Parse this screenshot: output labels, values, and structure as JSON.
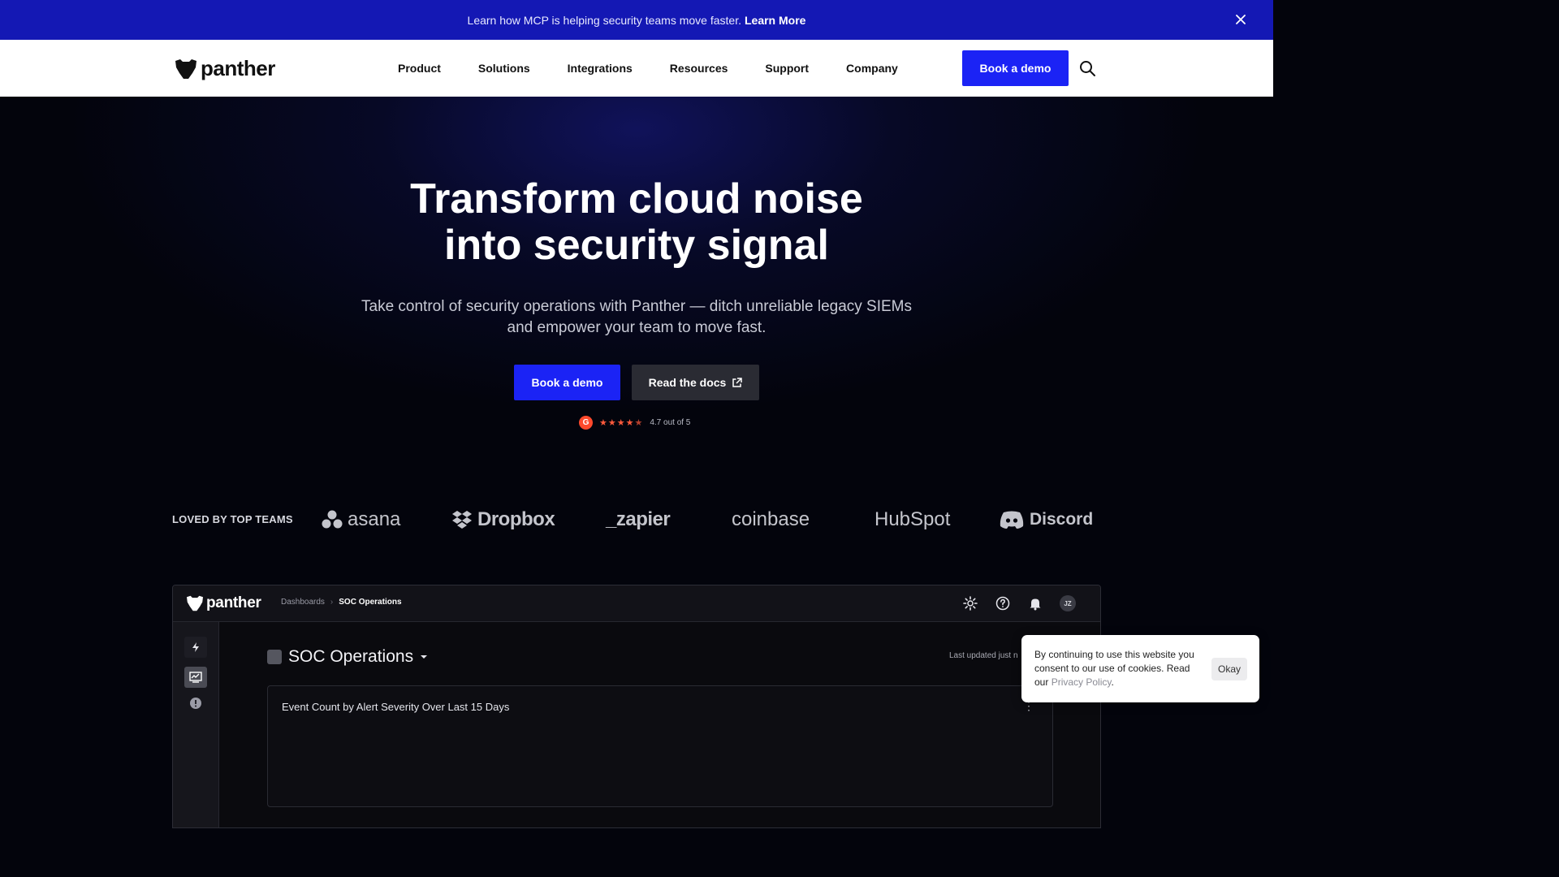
{
  "announcement": {
    "text": "Learn how MCP is helping security teams move faster.",
    "link": "Learn More"
  },
  "nav": {
    "logo": "panther",
    "links": [
      "Product",
      "Solutions",
      "Integrations",
      "Resources",
      "Support",
      "Company"
    ],
    "cta": "Book a demo"
  },
  "hero": {
    "title_line1": "Transform cloud noise",
    "title_line2": "into security signal",
    "subtitle_line1": "Take control of security operations with Panther — ditch unreliable legacy SIEMs",
    "subtitle_line2": "and empower your team to move fast.",
    "primary_cta": "Book a demo",
    "secondary_cta": "Read the docs",
    "rating_text": "4.7 out of 5",
    "rating_value": 4.7,
    "rating_max": 5
  },
  "logos": {
    "label": "LOVED BY TOP TEAMS",
    "brands": [
      "asana",
      "Dropbox",
      "_zapier",
      "coinbase",
      "HubSpot",
      "Discord"
    ]
  },
  "app": {
    "logo": "panther",
    "breadcrumb": [
      "Dashboards",
      "SOC Operations"
    ],
    "avatar": "JZ",
    "dashboard_title": "SOC Operations",
    "last_updated": "Last updated just n",
    "panel_title": "Event Count by Alert Severity Over Last 15 Days"
  },
  "cookie": {
    "text": "By continuing to use this website you consent to our use of cookies. Read our",
    "link": "Privacy Policy",
    "period": ".",
    "button": "Okay"
  },
  "colors": {
    "announce_bg": "#1418b4",
    "brand_blue": "#1b23f5",
    "hero_bg": "#03040c",
    "g2_red": "#ff492c"
  }
}
